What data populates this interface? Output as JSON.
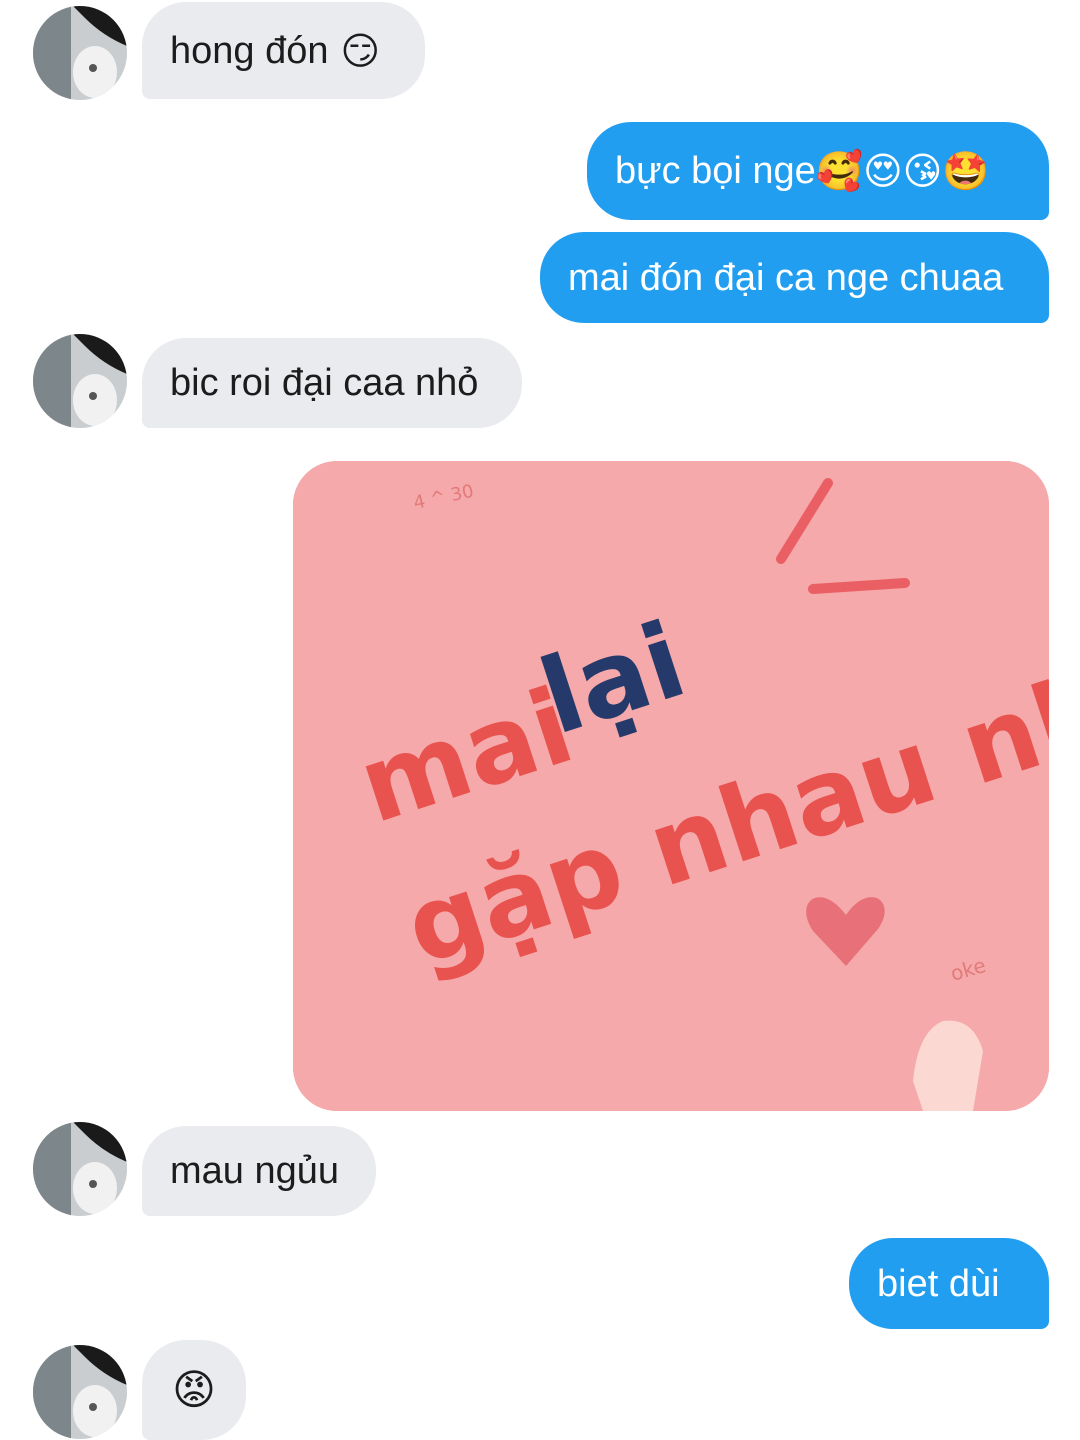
{
  "messages": [
    {
      "side": "in",
      "text": "hong đón",
      "emoji": "😏"
    },
    {
      "side": "out",
      "text": "bực bọi nge",
      "emoji": "🥰😍😘🤩"
    },
    {
      "side": "out",
      "text": "mai đón đại ca nge chuaa"
    },
    {
      "side": "in",
      "text": "bic roi đại caa nhỏ"
    },
    {
      "side": "out",
      "type": "image",
      "image_text": {
        "line1a": "mai",
        "line1b": "lại",
        "line2": "gặp nhau nhá",
        "corner_top": "4 ^ 30",
        "corner_bottom": "oke"
      }
    },
    {
      "side": "in",
      "text": "mau ngủu"
    },
    {
      "side": "out",
      "text": "biet dùi"
    },
    {
      "side": "in",
      "emoji": "😡"
    }
  ],
  "colors": {
    "incoming_bubble": "#e9ebee",
    "outgoing_bubble": "#229ef1",
    "image_background": "#f5a9aa",
    "handwriting_red": "#e8534f",
    "handwriting_blue": "#253a6b"
  }
}
